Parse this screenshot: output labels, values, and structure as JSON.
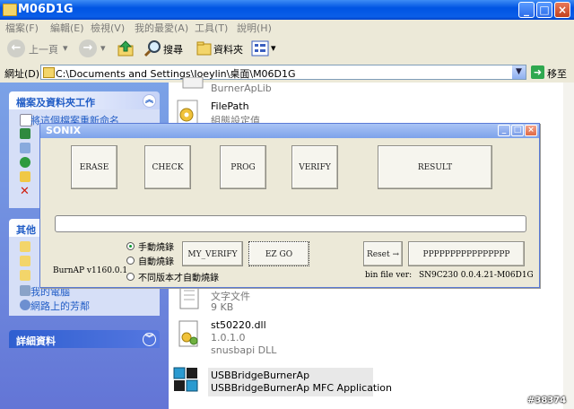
{
  "window": {
    "title": "M06D1G"
  },
  "menu": [
    "檔案(F)",
    "編輯(E)",
    "檢視(V)",
    "我的最愛(A)",
    "工具(T)",
    "說明(H)"
  ],
  "toolbar": {
    "back": "上一頁",
    "search": "搜尋",
    "folders": "資料夾"
  },
  "address": {
    "label": "網址(D)",
    "path": "C:\\Documents and Settings\\Joeylin\\桌面\\M06D1G",
    "go": "移至"
  },
  "leftpane": {
    "tasks_header": "檔案及資料夾工作",
    "task_first": "將這個檔案重新命名",
    "other_header": "其他",
    "places": [
      "我的電腦",
      "網路上的芳鄰"
    ],
    "details_header": "詳細資料"
  },
  "files": [
    {
      "name": "BurnerApLib",
      "sub": ""
    },
    {
      "name": "FilePath",
      "sub": "組態設定值"
    },
    {
      "name": "",
      "sub1": "文字文件",
      "sub2": "9 KB"
    },
    {
      "name": "st50220.dll",
      "sub1": "1.0.1.0",
      "sub2": "snusbapi DLL"
    },
    {
      "name": "USBBridgeBurnerAp",
      "sub": "USBBridgeBurnerAp MFC Application"
    }
  ],
  "dialog": {
    "title": "SONIX",
    "erase": "ERASE",
    "check": "CHECK",
    "prog": "PROG",
    "verify": "VERIFY",
    "result": "RESULT",
    "progress": 0,
    "radio_manual": "手動燒錄",
    "radio_auto": "自動燒錄",
    "radio_diff": "不同版本才自動燒錄",
    "version": "BurnAP v1160.0.1",
    "my_verify": "MY_VERIFY",
    "ezgo": "EZ GO",
    "reset": "Reset →",
    "pbutton": "PPPPPPPPPPPPPPPP",
    "binlabel": "bin file ver:",
    "binver": "SN9C230 0.0.4.21-M06D1G"
  },
  "watermark": "#38374",
  "colors": {
    "xp_blue": "#0054e3",
    "pane_blue": "#6375d6",
    "dialog_bg": "#ece9d8"
  }
}
